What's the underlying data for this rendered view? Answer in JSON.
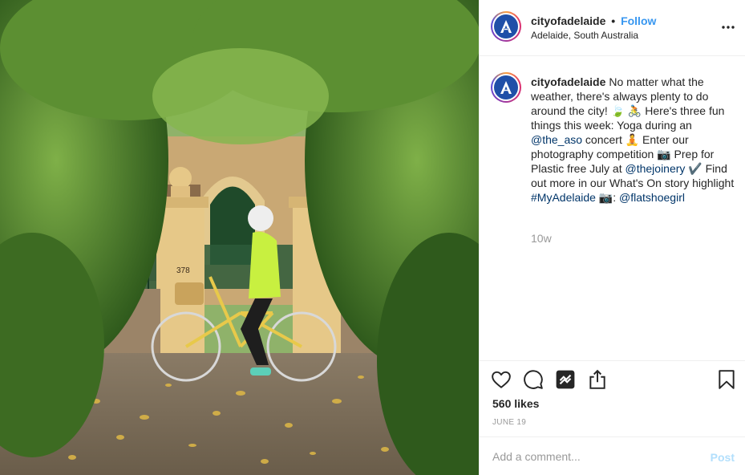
{
  "header": {
    "username": "cityofadelaide",
    "separator": "•",
    "follow_label": "Follow",
    "location": "Adelaide, South Australia",
    "more_label": "•••",
    "avatar_icon": "city-of-adelaide-logo"
  },
  "caption": {
    "username": "cityofadelaide",
    "segments": [
      {
        "text": "No matter what the weather, there's always plenty to do around the city! 🍃 🚴 Here's three fun things this week: Yoga during an "
      },
      {
        "text": "@the_aso",
        "link": true
      },
      {
        "text": " concert 🧘 Enter our photography competition 📷 Prep for Plastic free July at "
      },
      {
        "text": "@thejoinery",
        "link": true
      },
      {
        "text": " ✔️ Find out more in our What's On story highlight "
      },
      {
        "text": "#MyAdelaide",
        "link": true
      },
      {
        "text": " 📷: "
      },
      {
        "text": "@flatshoegirl",
        "link": true
      }
    ],
    "age": "10w"
  },
  "actions": {
    "icons": [
      "heart-icon",
      "comment-icon",
      "share-icon",
      "upload-icon",
      "bookmark-icon"
    ]
  },
  "likes": "560 likes",
  "date": "JUNE 19",
  "comment_box": {
    "placeholder": "Add a comment...",
    "post_label": "Post"
  },
  "photo": {
    "gate_number": "378",
    "description_icon": "bicycle"
  },
  "colors": {
    "link": "#003569",
    "follow": "#3897f0",
    "muted": "#999999",
    "post_disabled": "#b2dffc",
    "avatar_blue": "#1f4fa8"
  }
}
